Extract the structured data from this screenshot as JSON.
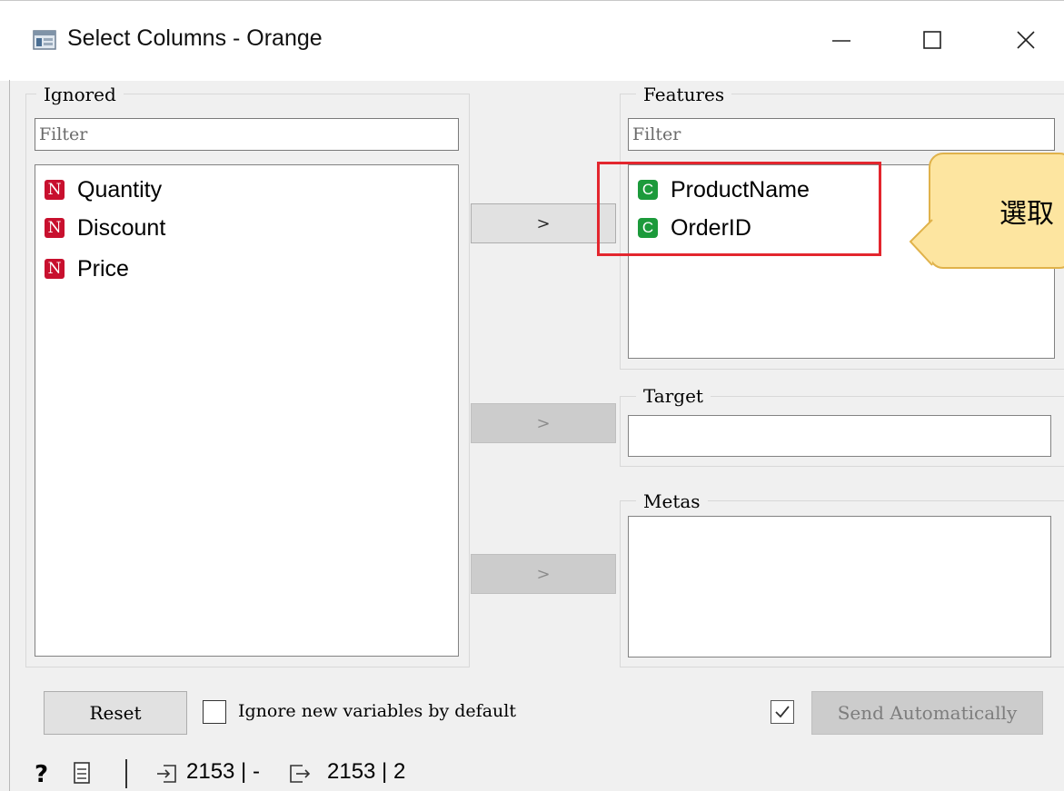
{
  "window": {
    "title": "Select Columns - Orange",
    "buttons": {
      "minimize": "—",
      "maximize": "☐",
      "close": "✕"
    }
  },
  "ignored": {
    "title": "Ignored",
    "filter_placeholder": "Filter",
    "items": [
      {
        "badge": "N",
        "label": "Quantity"
      },
      {
        "badge": "N",
        "label": "Discount"
      },
      {
        "badge": "N",
        "label": "Price"
      }
    ]
  },
  "features": {
    "title": "Features",
    "filter_placeholder": "Filter",
    "items": [
      {
        "badge": "C",
        "label": "ProductName"
      },
      {
        "badge": "C",
        "label": "OrderID"
      }
    ]
  },
  "target": {
    "title": "Target"
  },
  "metas": {
    "title": "Metas"
  },
  "move_buttons": {
    "features": ">",
    "target": ">",
    "metas": ">"
  },
  "footer": {
    "reset_label": "Reset",
    "ignore_new_label": "Ignore new variables by default",
    "ignore_new_checked": false,
    "send_auto_checked": true,
    "send_label": "Send Automatically"
  },
  "status_bar": {
    "input_count": "2153 | -",
    "output_count": "2153 | 2"
  },
  "callout": {
    "text": "選取"
  },
  "colors": {
    "numeric_badge": "#c8102e",
    "categorical_badge": "#1c9a3b",
    "highlight": "#e3262e",
    "callout_fill": "#fde5a0"
  }
}
